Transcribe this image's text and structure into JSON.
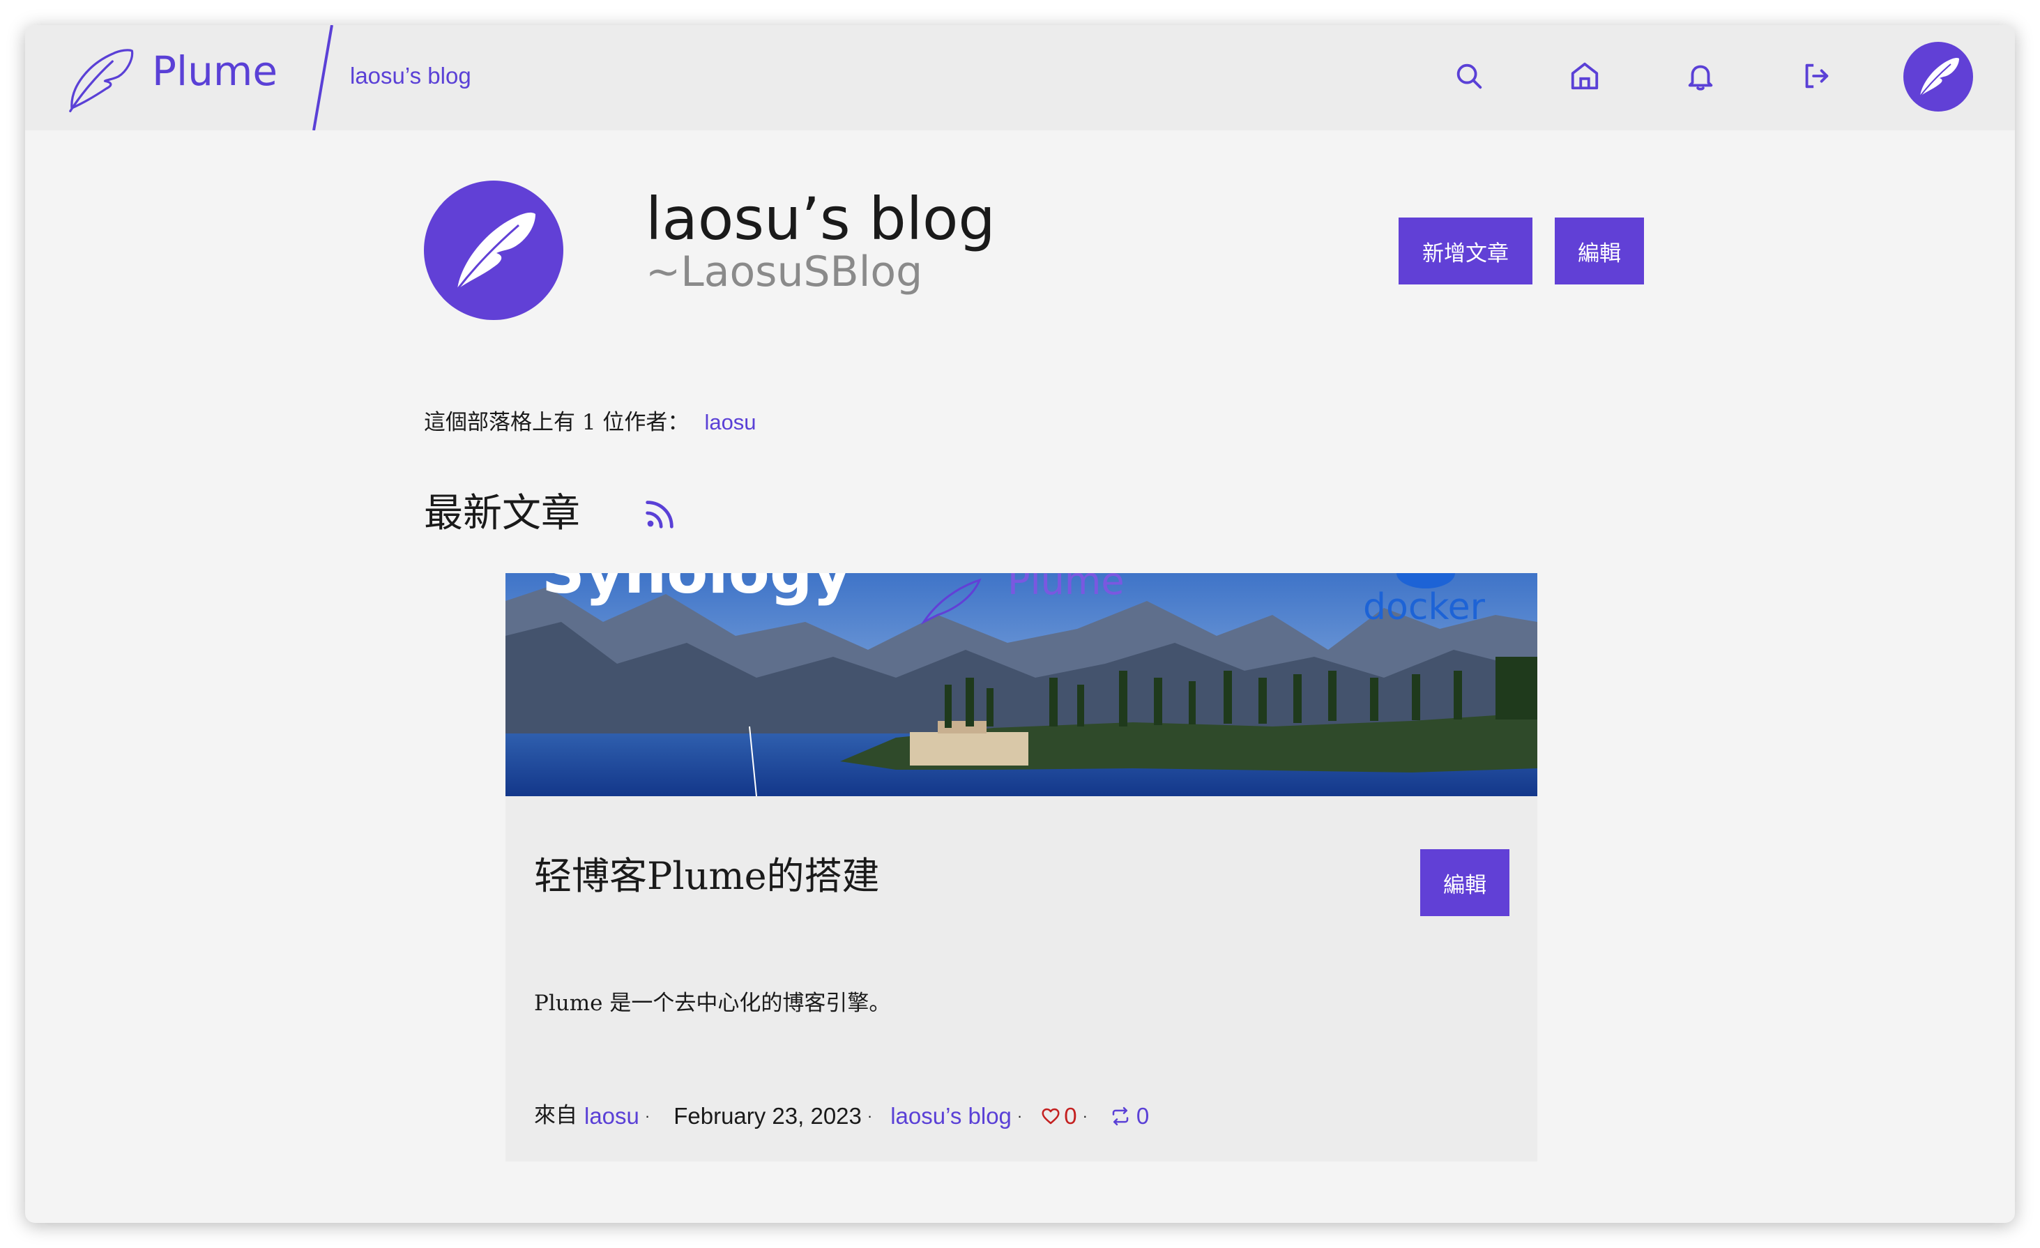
{
  "colors": {
    "accent": "#6140d6",
    "accent_text": "#5a40d6",
    "like": "#c42020",
    "header_bg": "#ececec",
    "page_bg": "#f4f4f4"
  },
  "header": {
    "app_name": "Plume",
    "blog_name": "laosu’s blog",
    "nav_icons": [
      "search-icon",
      "home-icon",
      "bell-icon",
      "logout-icon"
    ]
  },
  "blog": {
    "title": "laosu’s blog",
    "handle": "~LaosuSBlog",
    "new_article_label": "新增文章",
    "edit_label": "編輯",
    "authors_prefix": "這個部落格上有 1 位作者：",
    "author": "laosu"
  },
  "latest": {
    "title": "最新文章",
    "rss_icon": "rss-icon"
  },
  "article": {
    "cover_texts": {
      "synology": "Synology",
      "plume": "Plume",
      "docker": "docker"
    },
    "title": "轻博客Plume的搭建",
    "edit_label": "編輯",
    "excerpt": "Plume 是一个去中心化的博客引擎。",
    "from_label": "來自",
    "author": "laosu",
    "date": "February 23, 2023",
    "blog": "laosu’s blog",
    "likes": "0",
    "reshares": "0"
  }
}
